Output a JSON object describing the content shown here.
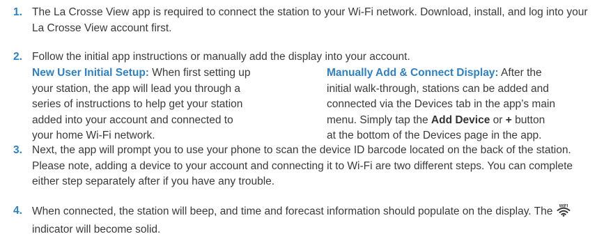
{
  "steps": [
    {
      "num": "1.",
      "text": "The La Crosse View app is required to connect the station to your Wi-Fi network. Download, install, and log into your La Crosse View account first."
    },
    {
      "num": "2.",
      "text": "Follow the initial app instructions or manually add the display into your account."
    },
    {
      "num": "3.",
      "text": "Next, the app will prompt you to use your phone to scan the device ID barcode located on the back of the station. Please note, adding a device to your account and connecting it to Wi-Fi are two different steps. You can complete either step separately after if you have any trouble."
    },
    {
      "num": "4.",
      "text_before": "When connected, the station will beep, and time and forecast information should populate on the display. The ",
      "text_after": " indicator will become solid."
    }
  ],
  "new_user": {
    "title": "New User Initial Setup:",
    "body": " When first setting up your station, the app will lead you through a series of instructions to help get your station added into your account and connected to your home Wi-Fi network."
  },
  "manual": {
    "title": "Manually Add & Connect Display:",
    "body1": " After the initial walk-through, stations can be added and connected via the Devices tab in the app’s main menu. Simply tap the ",
    "add_device": "Add Device",
    "or": " or ",
    "plus": "+",
    "body2": " button at the bottom of the Devices page in the app."
  },
  "wifi_icon": {
    "name": "wifi-icon",
    "label": "WIFI",
    "color": "#3a3a3a"
  },
  "colors": {
    "accent": "#2f80c4",
    "text": "#3a3a3a"
  }
}
